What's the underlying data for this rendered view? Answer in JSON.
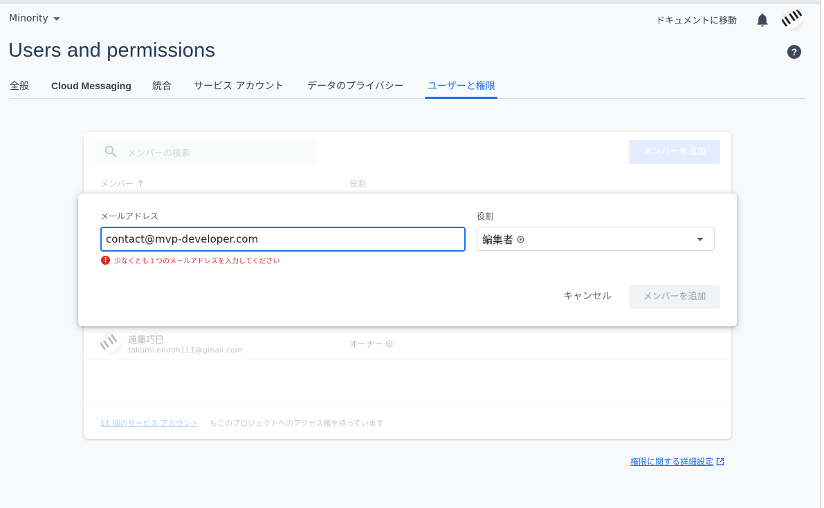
{
  "header": {
    "project_name": "Minority",
    "docs_link": "ドキュメントに移動",
    "page_title": "Users and permissions"
  },
  "tabs": [
    {
      "label": "全般",
      "active": false
    },
    {
      "label": "Cloud Messaging",
      "active": false
    },
    {
      "label": "統合",
      "active": false
    },
    {
      "label": "サービス アカウント",
      "active": false
    },
    {
      "label": "データのプライバシー",
      "active": false
    },
    {
      "label": "ユーザーと権限",
      "active": true
    }
  ],
  "members_card": {
    "search_placeholder": "メンバーの検索",
    "add_member_label": "メンバーを追加",
    "column_member": "メンバー",
    "column_role": "役割",
    "members": [
      {
        "name": "遠藤巧巳",
        "email": "takumi.endoh111@gmail.com",
        "role": "オーナー"
      }
    ],
    "footer_link": "11 個のサービス アカウント",
    "footer_text": "もこのプロジェクトへのアクセス権を持っています"
  },
  "dialog": {
    "email_label": "メールアドレス",
    "email_value": "contact@mvp-developer.com",
    "error_message": "少なくとも１つのメールアドレスを入力してください",
    "role_label": "役割",
    "role_value": "編集者",
    "cancel_label": "キャンセル",
    "add_member_label": "メンバーを追加"
  },
  "settings_link": "権限に関する詳細設定",
  "colors": {
    "accent": "#1a73e8",
    "error": "#d93025",
    "title": "#1f3a5a"
  }
}
